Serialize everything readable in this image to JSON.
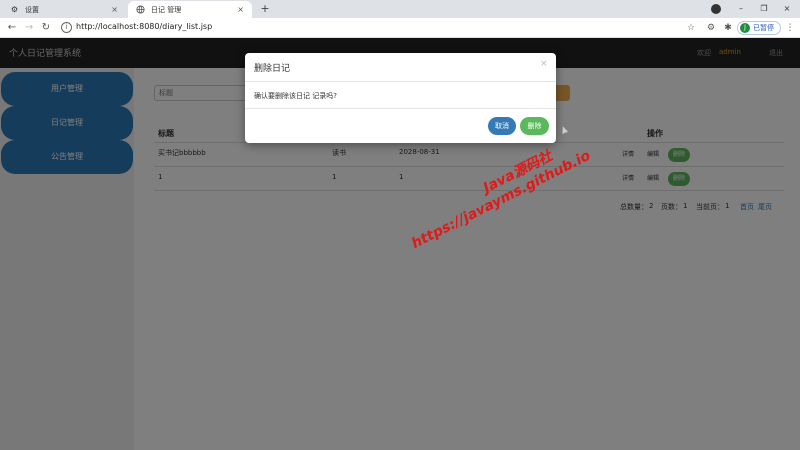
{
  "browser": {
    "tabs": [
      {
        "title": "设置",
        "icon": "gear-icon",
        "close": "×"
      },
      {
        "title": "日记 管理",
        "icon": "globe-icon",
        "close": "×"
      }
    ],
    "new_tab": "+",
    "url": "http://localhost:8080/diary_list.jsp",
    "profile_initial": "J",
    "profile_status": "已暂停",
    "window_controls": {
      "minimize": "–",
      "restore": "❐",
      "close": "×"
    }
  },
  "app": {
    "title": "个人日记管理系统",
    "welcome": "欢迎",
    "username": "admin",
    "logout": "退出"
  },
  "sidebar": {
    "items": [
      {
        "label": "用户管理"
      },
      {
        "label": "日记管理"
      },
      {
        "label": "公告管理"
      }
    ]
  },
  "search": {
    "placeholder": "标题"
  },
  "table": {
    "headers": {
      "title": "标题",
      "actions": "操作"
    },
    "rows": [
      {
        "title": "买书记bbbbbb",
        "category": "读书",
        "date": "2028-08-31"
      },
      {
        "title": "1",
        "category": "1",
        "date": "1"
      }
    ],
    "actions": {
      "detail": "详情",
      "edit": "编辑",
      "delete": "删除"
    }
  },
  "pager": {
    "total_label": "总数量：",
    "total": "2",
    "pages_label": "页数：",
    "pages": "1",
    "current_label": "当前页：",
    "current": "1",
    "first": "首页",
    "last": "尾页"
  },
  "modal": {
    "title": "删除日记",
    "close": "×",
    "message": "确认要删除该日记 记录吗?",
    "cancel": "取消",
    "confirm": "删除"
  },
  "watermark": {
    "line1": "Java源码社",
    "line2": "https://javayms.github.io"
  },
  "colors": {
    "header_bg": "#222222",
    "sidebar_item": "#2a7ab7",
    "primary": "#337ab7",
    "success": "#5cb85c",
    "warning": "#f0ad4e",
    "watermark": "#e31818"
  }
}
